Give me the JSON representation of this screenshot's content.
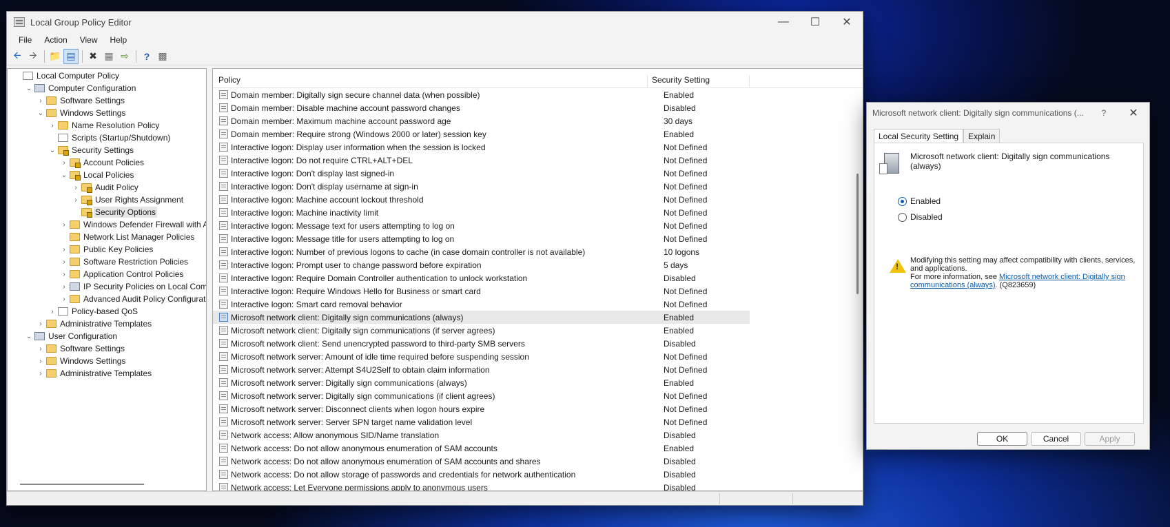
{
  "window": {
    "title": "Local Group Policy Editor"
  },
  "menu": [
    "File",
    "Action",
    "View",
    "Help"
  ],
  "toolbar": {
    "back_icon": "back-arrow-icon",
    "forward_icon": "forward-arrow-icon"
  },
  "tree": [
    {
      "label": "Local Computer Policy",
      "depth": 0,
      "chev": "",
      "icon": "doc"
    },
    {
      "label": "Computer Configuration",
      "depth": 1,
      "chev": "⌄",
      "icon": "pc"
    },
    {
      "label": "Software Settings",
      "depth": 2,
      "chev": "›",
      "icon": "folder"
    },
    {
      "label": "Windows Settings",
      "depth": 2,
      "chev": "⌄",
      "icon": "folder"
    },
    {
      "label": "Name Resolution Policy",
      "depth": 3,
      "chev": "›",
      "icon": "folder"
    },
    {
      "label": "Scripts (Startup/Shutdown)",
      "depth": 3,
      "chev": "",
      "icon": "doc"
    },
    {
      "label": "Security Settings",
      "depth": 3,
      "chev": "⌄",
      "icon": "folder lock"
    },
    {
      "label": "Account Policies",
      "depth": 4,
      "chev": "›",
      "icon": "folder lock"
    },
    {
      "label": "Local Policies",
      "depth": 4,
      "chev": "⌄",
      "icon": "folder lock"
    },
    {
      "label": "Audit Policy",
      "depth": 5,
      "chev": "›",
      "icon": "folder lock"
    },
    {
      "label": "User Rights Assignment",
      "depth": 5,
      "chev": "›",
      "icon": "folder lock"
    },
    {
      "label": "Security Options",
      "depth": 5,
      "chev": "",
      "icon": "folder lock",
      "selected": true
    },
    {
      "label": "Windows Defender Firewall with Ad",
      "depth": 4,
      "chev": "›",
      "icon": "folder"
    },
    {
      "label": "Network List Manager Policies",
      "depth": 4,
      "chev": "",
      "icon": "folder"
    },
    {
      "label": "Public Key Policies",
      "depth": 4,
      "chev": "›",
      "icon": "folder"
    },
    {
      "label": "Software Restriction Policies",
      "depth": 4,
      "chev": "›",
      "icon": "folder"
    },
    {
      "label": "Application Control Policies",
      "depth": 4,
      "chev": "›",
      "icon": "folder"
    },
    {
      "label": "IP Security Policies on Local Compu",
      "depth": 4,
      "chev": "›",
      "icon": "pc"
    },
    {
      "label": "Advanced Audit Policy Configuratio",
      "depth": 4,
      "chev": "›",
      "icon": "folder"
    },
    {
      "label": "Policy-based QoS",
      "depth": 3,
      "chev": "›",
      "icon": "doc"
    },
    {
      "label": "Administrative Templates",
      "depth": 2,
      "chev": "›",
      "icon": "folder"
    },
    {
      "label": "User Configuration",
      "depth": 1,
      "chev": "⌄",
      "icon": "pc"
    },
    {
      "label": "Software Settings",
      "depth": 2,
      "chev": "›",
      "icon": "folder"
    },
    {
      "label": "Windows Settings",
      "depth": 2,
      "chev": "›",
      "icon": "folder"
    },
    {
      "label": "Administrative Templates",
      "depth": 2,
      "chev": "›",
      "icon": "folder"
    }
  ],
  "list": {
    "col_policy": "Policy",
    "col_setting": "Security Setting",
    "rows": [
      {
        "policy": "Domain member: Digitally sign secure channel data (when possible)",
        "setting": "Enabled"
      },
      {
        "policy": "Domain member: Disable machine account password changes",
        "setting": "Disabled"
      },
      {
        "policy": "Domain member: Maximum machine account password age",
        "setting": "30 days"
      },
      {
        "policy": "Domain member: Require strong (Windows 2000 or later) session key",
        "setting": "Enabled"
      },
      {
        "policy": "Interactive logon: Display user information when the session is locked",
        "setting": "Not Defined"
      },
      {
        "policy": "Interactive logon: Do not require CTRL+ALT+DEL",
        "setting": "Not Defined"
      },
      {
        "policy": "Interactive logon: Don't display last signed-in",
        "setting": "Not Defined"
      },
      {
        "policy": "Interactive logon: Don't display username at sign-in",
        "setting": "Not Defined"
      },
      {
        "policy": "Interactive logon: Machine account lockout threshold",
        "setting": "Not Defined"
      },
      {
        "policy": "Interactive logon: Machine inactivity limit",
        "setting": "Not Defined"
      },
      {
        "policy": "Interactive logon: Message text for users attempting to log on",
        "setting": "Not Defined"
      },
      {
        "policy": "Interactive logon: Message title for users attempting to log on",
        "setting": "Not Defined"
      },
      {
        "policy": "Interactive logon: Number of previous logons to cache (in case domain controller is not available)",
        "setting": "10 logons"
      },
      {
        "policy": "Interactive logon: Prompt user to change password before expiration",
        "setting": "5 days"
      },
      {
        "policy": "Interactive logon: Require Domain Controller authentication to unlock workstation",
        "setting": "Disabled"
      },
      {
        "policy": "Interactive logon: Require Windows Hello for Business or smart card",
        "setting": "Not Defined"
      },
      {
        "policy": "Interactive logon: Smart card removal behavior",
        "setting": "Not Defined"
      },
      {
        "policy": "Microsoft network client: Digitally sign communications (always)",
        "setting": "Enabled",
        "selected": true
      },
      {
        "policy": "Microsoft network client: Digitally sign communications (if server agrees)",
        "setting": "Enabled"
      },
      {
        "policy": "Microsoft network client: Send unencrypted password to third-party SMB servers",
        "setting": "Disabled"
      },
      {
        "policy": "Microsoft network server: Amount of idle time required before suspending session",
        "setting": "Not Defined"
      },
      {
        "policy": "Microsoft network server: Attempt S4U2Self to obtain claim information",
        "setting": "Not Defined"
      },
      {
        "policy": "Microsoft network server: Digitally sign communications (always)",
        "setting": "Enabled"
      },
      {
        "policy": "Microsoft network server: Digitally sign communications (if client agrees)",
        "setting": "Not Defined"
      },
      {
        "policy": "Microsoft network server: Disconnect clients when logon hours expire",
        "setting": "Not Defined"
      },
      {
        "policy": "Microsoft network server: Server SPN target name validation level",
        "setting": "Not Defined"
      },
      {
        "policy": "Network access: Allow anonymous SID/Name translation",
        "setting": "Disabled"
      },
      {
        "policy": "Network access: Do not allow anonymous enumeration of SAM accounts",
        "setting": "Enabled"
      },
      {
        "policy": "Network access: Do not allow anonymous enumeration of SAM accounts and shares",
        "setting": "Disabled"
      },
      {
        "policy": "Network access: Do not allow storage of passwords and credentials for network authentication",
        "setting": "Disabled"
      },
      {
        "policy": "Network access: Let Everyone permissions apply to anonymous users",
        "setting": "Disabled"
      }
    ]
  },
  "dialog": {
    "title": "Microsoft network client: Digitally sign communications (...",
    "help": "?",
    "tabs": [
      "Local Security Setting",
      "Explain"
    ],
    "policy_name": "Microsoft network client: Digitally sign communications (always)",
    "radio_enabled": "Enabled",
    "radio_disabled": "Disabled",
    "selected": "Enabled",
    "warning_line1": "Modifying this setting may affect compatibility with clients, services, and applications.",
    "warning_prefix": "For more information, see ",
    "warning_link": "Microsoft network client: Digitally sign communications (always)",
    "warning_suffix": ". (Q823659)",
    "ok": "OK",
    "cancel": "Cancel",
    "apply": "Apply"
  }
}
